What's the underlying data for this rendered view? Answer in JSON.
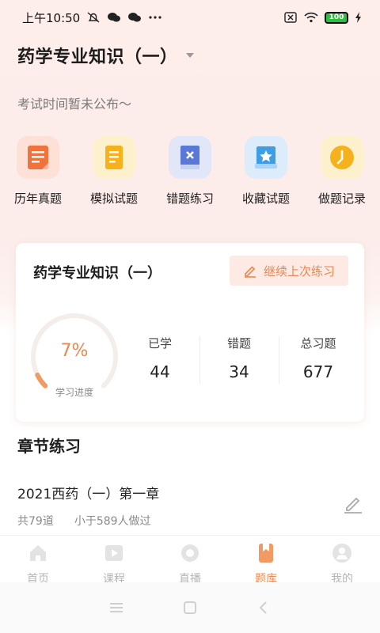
{
  "status_bar": {
    "time": "上午10:50",
    "battery": "100"
  },
  "header": {
    "title": "药学专业知识（一）",
    "exam_note": "考试时间暂未公布～"
  },
  "quick_actions": [
    {
      "label": "历年真题",
      "icon": "document-icon",
      "color": "#f0723c"
    },
    {
      "label": "模拟试题",
      "icon": "paper-icon",
      "color": "#f6b21c"
    },
    {
      "label": "错题练习",
      "icon": "wrong-book-icon",
      "color": "#5a78d6"
    },
    {
      "label": "收藏试题",
      "icon": "star-book-icon",
      "color": "#3d9ee6"
    },
    {
      "label": "做题记录",
      "icon": "clock-icon",
      "color": "#f6b21c"
    }
  ],
  "study_card": {
    "title": "药学专业知识（一）",
    "continue_label": "继续上次练习",
    "progress_percent": 7,
    "progress_text": "7%",
    "progress_label": "学习进度",
    "stats": [
      {
        "label": "已学",
        "value": "44"
      },
      {
        "label": "错题",
        "value": "34"
      },
      {
        "label": "总习题",
        "value": "677"
      }
    ]
  },
  "chapters": {
    "section_title": "章节练习",
    "items": [
      {
        "name": "2021西药（一）第一章",
        "count": "共79道",
        "done": "小于589人做过"
      }
    ]
  },
  "tab_bar": {
    "tabs": [
      {
        "label": "首页",
        "icon": "home-icon"
      },
      {
        "label": "课程",
        "icon": "course-icon"
      },
      {
        "label": "直播",
        "icon": "live-icon"
      },
      {
        "label": "题库",
        "icon": "question-bank-icon",
        "active": true
      },
      {
        "label": "我的",
        "icon": "profile-icon"
      }
    ]
  }
}
